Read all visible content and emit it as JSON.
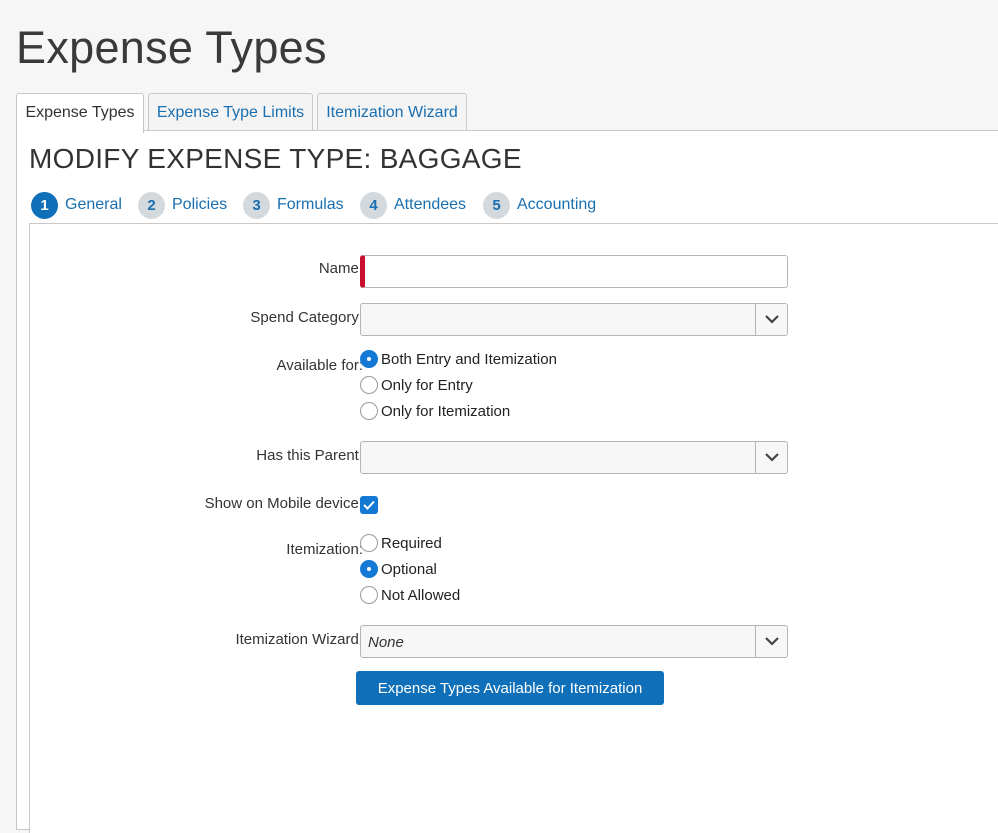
{
  "page": {
    "title": "Expense Types"
  },
  "tabs": [
    {
      "label": "Expense Types",
      "active": true
    },
    {
      "label": "Expense Type Limits",
      "active": false
    },
    {
      "label": "Itemization Wizard",
      "active": false
    }
  ],
  "section": {
    "title": "MODIFY EXPENSE TYPE: BAGGAGE"
  },
  "steps": [
    {
      "number": "1",
      "label": "General",
      "active": true
    },
    {
      "number": "2",
      "label": "Policies",
      "active": false
    },
    {
      "number": "3",
      "label": "Formulas",
      "active": false
    },
    {
      "number": "4",
      "label": "Attendees",
      "active": false
    },
    {
      "number": "5",
      "label": "Accounting",
      "active": false
    }
  ],
  "form": {
    "name": {
      "label": "Name:",
      "value": "",
      "required": true
    },
    "spend_category": {
      "label": "Spend Category:",
      "value": ""
    },
    "available_for": {
      "label": "Available for:",
      "options": [
        "Both Entry and Itemization",
        "Only for Entry",
        "Only for Itemization"
      ],
      "selected": "Both Entry and Itemization"
    },
    "has_parent": {
      "label": "Has this Parent:",
      "value": ""
    },
    "show_mobile": {
      "label": "Show on Mobile device:",
      "checked": true
    },
    "itemization": {
      "label": "Itemization:",
      "options": [
        "Required",
        "Optional",
        "Not Allowed"
      ],
      "selected": "Optional"
    },
    "itemization_wizard": {
      "label": "Itemization Wizard:",
      "value": "None"
    },
    "button_label": "Expense Types Available for Itemization"
  },
  "icons": {
    "select_caret": "chevron-down-icon",
    "checkbox_mark": "checkmark-icon"
  },
  "colors": {
    "accent": "#0f6fb8",
    "required_marker": "#c8102e",
    "link": "#1a6fb0"
  }
}
